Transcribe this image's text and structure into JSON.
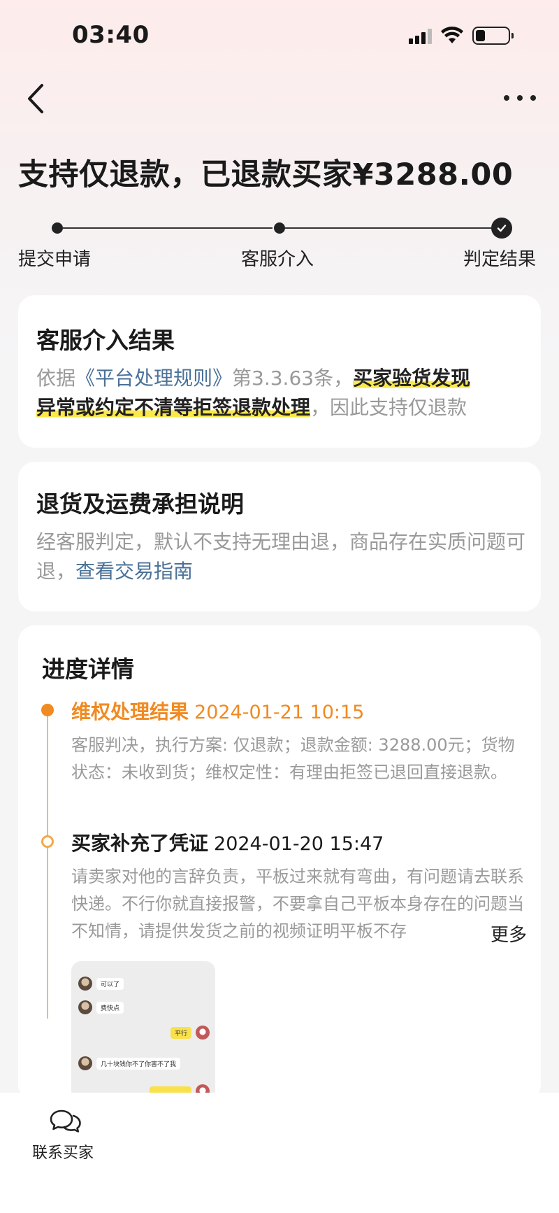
{
  "status_bar": {
    "time": "03:40"
  },
  "headline": "支持仅退款，已退款买家¥3288.00",
  "steps": [
    {
      "label": "提交申请"
    },
    {
      "label": "客服介入"
    },
    {
      "label": "判定结果"
    }
  ],
  "result_card": {
    "title": "客服介入结果",
    "text_pre": "依据",
    "rule_link": "《平台处理规则》",
    "text_mid": "第3.3.63条，",
    "highlight_1": "买家验货发现",
    "highlight_2": "异常或约定不清等拒签退款处理",
    "text_post": "，因此支持仅退款"
  },
  "return_card": {
    "title": "退货及运费承担说明",
    "text": "经客服判定，默认不支持无理由退，商品存在实质问题可退，",
    "guide_link": "查看交易指南"
  },
  "progress": {
    "title": "进度详情",
    "events": [
      {
        "title": "维权处理结果",
        "date": "2024-01-21 10:15",
        "text": "客服判决，执行方案: 仅退款；退款金额: 3288.00元；货物状态：未收到货；维权定性：有理由拒签已退回直接退款。"
      },
      {
        "title": "买家补充了凭证",
        "date": "2024-01-20 15:47",
        "text": "请卖家对他的言辞负责，平板过来就有弯曲，有问题请去联系快递。不行你就直接报警，不要拿自己平板本身存在的问题当不知情，请提供发货之前的视频证明平板不存",
        "more": "更多",
        "thumbnail_chat": [
          "可以了",
          "费快点",
          "平行",
          "几十块钱你不了你害不了我"
        ]
      }
    ]
  },
  "bottom_bar": {
    "contact_label": "联系买家"
  },
  "colors": {
    "accent_orange": "#f08a21",
    "link_blue": "#4a7198",
    "highlight_yellow": "#fbe84a"
  }
}
